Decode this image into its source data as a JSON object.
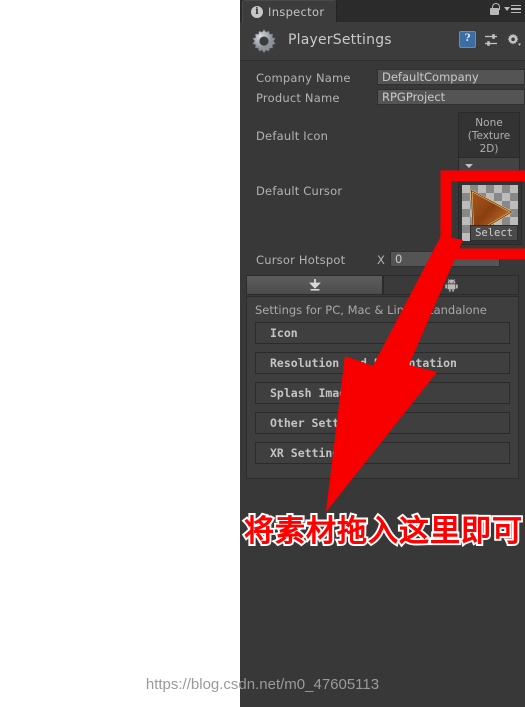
{
  "window": {
    "tab_label": "Inspector",
    "tab_icon": "info-icon",
    "lock_icon": "lock-icon",
    "menu_icon": "hamburger-menu-icon"
  },
  "object_header": {
    "icon": "gear-icon",
    "title": "PlayerSettings",
    "help_icon": "help-book-icon",
    "preset_icon": "preset-sliders-icon",
    "settings_icon": "gear-dropdown-icon"
  },
  "properties": [
    {
      "label": "Company Name",
      "value": "DefaultCompany",
      "type": "text"
    },
    {
      "label": "Product Name",
      "value": "RPGProject",
      "type": "text"
    }
  ],
  "default_icon": {
    "label": "Default Icon",
    "value": "None\n(Texture\n2D)",
    "line1": "None",
    "line2": "(Texture",
    "line3": "2D)"
  },
  "default_cursor": {
    "label": "Default Cursor",
    "select_label": "Select",
    "preview": "orange-arrow-cursor-texture"
  },
  "cursor_hotspot": {
    "label": "Cursor Hotspot",
    "axis_label": "X",
    "value": "0"
  },
  "platform_tabs": [
    {
      "name": "standalone",
      "icon": "download-standalone-icon",
      "selected": true
    },
    {
      "name": "android",
      "icon": "android-robot-icon",
      "selected": false
    }
  ],
  "settings": {
    "header": "Settings for PC, Mac & Linux Standalone",
    "sections": [
      {
        "label": "Icon"
      },
      {
        "label": "Resolution and Presentation"
      },
      {
        "label": "Splash Image"
      },
      {
        "label": "Other Settings"
      },
      {
        "label": "XR Settings"
      }
    ]
  },
  "annotation": {
    "text": "将素材拖入这里即可",
    "arrow": "red-down-left-arrow",
    "highlight_box": "red-rectangle-highlight",
    "color": "#ff0000",
    "outline_color": "#ffffff"
  },
  "watermark": {
    "text": "https://blog.csdn.net/m0_47605113"
  },
  "colors": {
    "panel_bg": "#383838",
    "field_bg": "#545454",
    "text": "#b3b3b3",
    "accent_red": "#ff0000",
    "help_blue": "#3b6ea5"
  }
}
